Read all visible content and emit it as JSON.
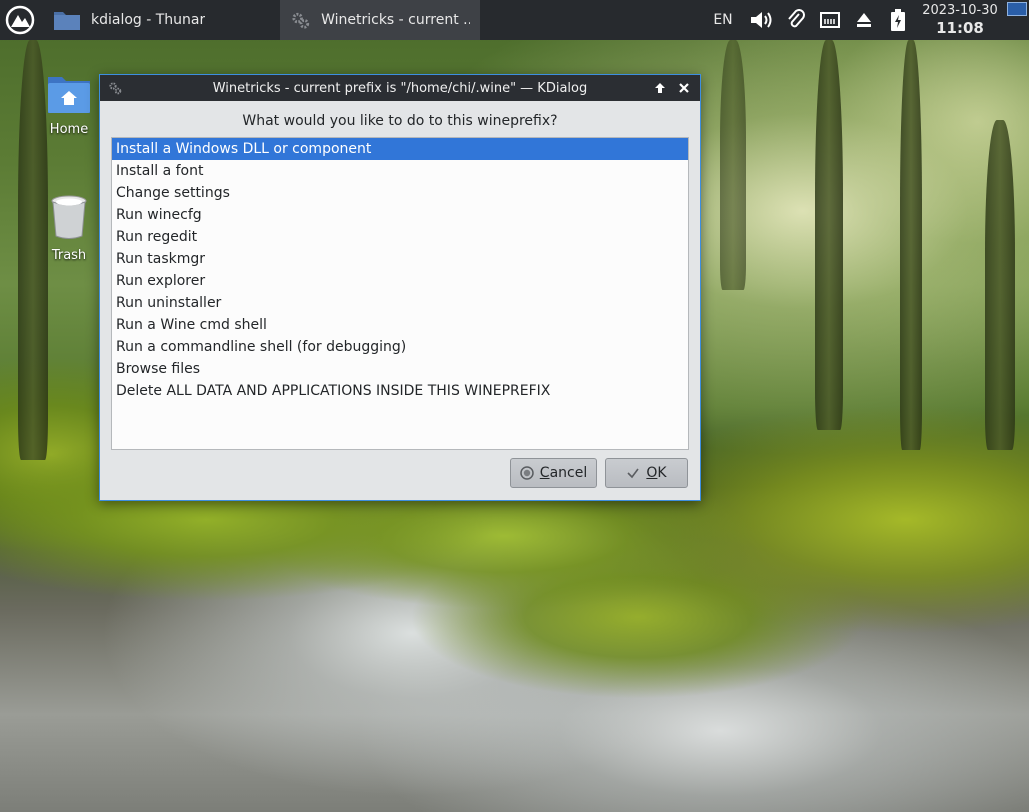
{
  "taskbar": {
    "tasks": [
      {
        "label": "kdialog - Thunar"
      },
      {
        "label": "Winetricks - current ..."
      }
    ],
    "tray": {
      "keyboard_layout": "EN",
      "date": "2023-10-30",
      "time": "11:08"
    }
  },
  "desktop": {
    "icons": [
      {
        "label": "Home"
      },
      {
        "label": "Trash"
      }
    ]
  },
  "dialog": {
    "title": "Winetricks - current prefix is \"/home/chi/.wine\" — KDialog",
    "prompt": "What would you like to do to this wineprefix?",
    "items": [
      {
        "label": "Install a Windows DLL or component",
        "selected": true
      },
      {
        "label": "Install a font"
      },
      {
        "label": "Change settings"
      },
      {
        "label": "Run winecfg"
      },
      {
        "label": "Run regedit"
      },
      {
        "label": "Run taskmgr"
      },
      {
        "label": "Run explorer"
      },
      {
        "label": "Run uninstaller"
      },
      {
        "label": "Run a Wine cmd shell"
      },
      {
        "label": "Run a commandline shell (for debugging)"
      },
      {
        "label": "Browse files"
      },
      {
        "label": "Delete ALL DATA AND APPLICATIONS INSIDE THIS WINEPREFIX"
      }
    ],
    "cancel_label": "Cancel",
    "ok_label": "OK"
  },
  "colors": {
    "selection": "#3176d8",
    "panel": "#272a2e",
    "dialog_border": "#3d8ee0"
  }
}
